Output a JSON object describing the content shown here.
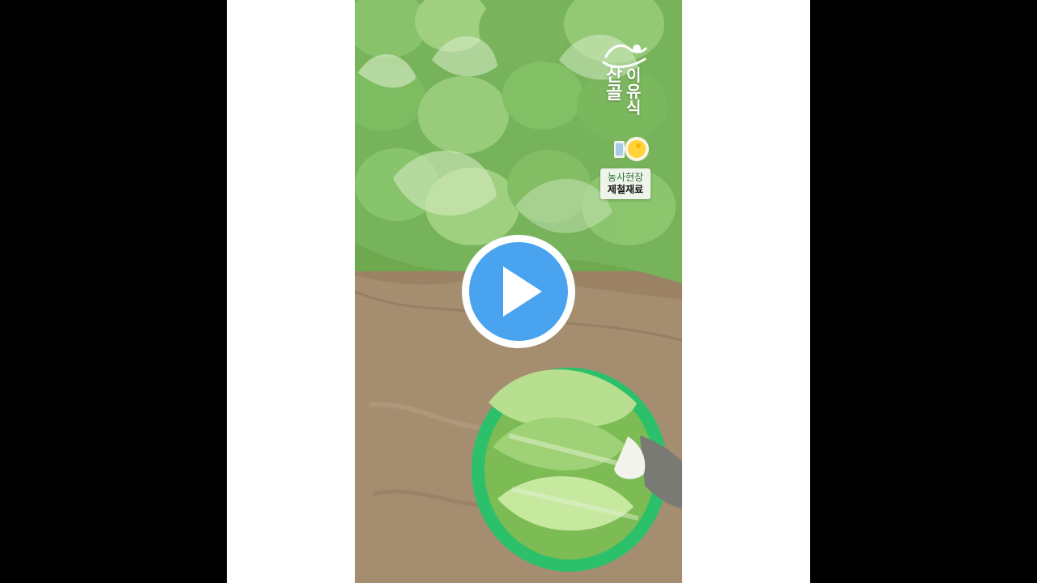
{
  "video": {
    "overlay": {
      "brand_sanol": "산골",
      "brand_iyusik": "이유식",
      "badge_line1": "농사현장",
      "badge_line2": "제철재료"
    },
    "play_icon": "play-icon",
    "colors": {
      "play_fill": "#4aa3ef",
      "play_ring": "#ffffff",
      "soil": "#9a8266",
      "cabbage": "#79b45b",
      "basket": "#2fb36b"
    }
  }
}
